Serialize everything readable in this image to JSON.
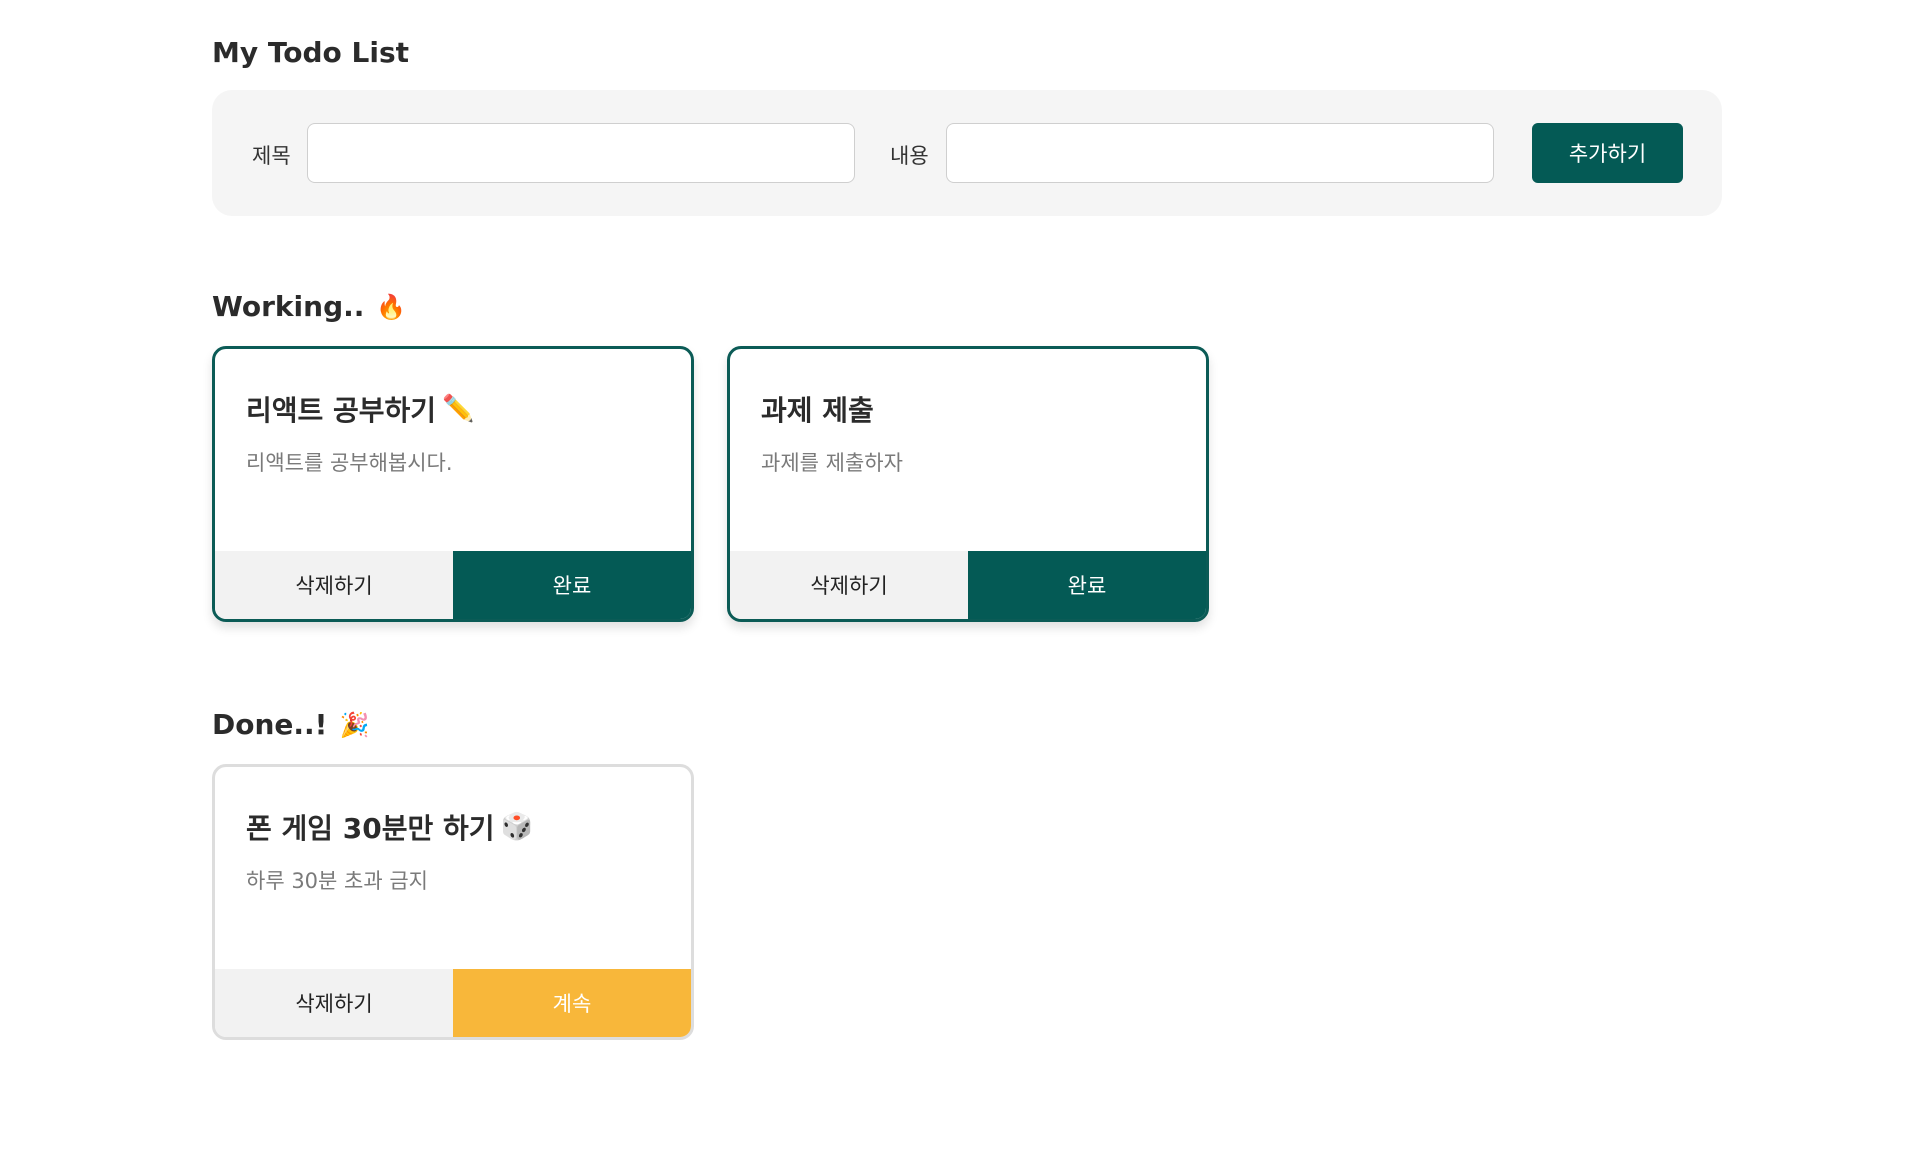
{
  "header": {
    "title": "My Todo List"
  },
  "form": {
    "title_label": "제목",
    "title_value": "",
    "content_label": "내용",
    "content_value": "",
    "add_label": "추가하기"
  },
  "working": {
    "title": "Working..",
    "emoji": "🔥",
    "cards": [
      {
        "title": "리액트 공부하기",
        "emoji": "✏️",
        "body": "리액트를 공부해봅시다.",
        "delete_label": "삭제하기",
        "toggle_label": "완료"
      },
      {
        "title": "과제 제출",
        "emoji": "",
        "body": "과제를 제출하자",
        "delete_label": "삭제하기",
        "toggle_label": "완료"
      }
    ]
  },
  "done": {
    "title": "Done..!",
    "emoji": "🎉",
    "cards": [
      {
        "title": "폰 게임 30분만 하기",
        "emoji": "🎲",
        "body": "하루 30분 초과 금지",
        "delete_label": "삭제하기",
        "toggle_label": "계속"
      }
    ]
  },
  "colors": {
    "primary": "#045a55",
    "continue": "#f8b73a",
    "panel_bg": "#f5f5f5"
  }
}
